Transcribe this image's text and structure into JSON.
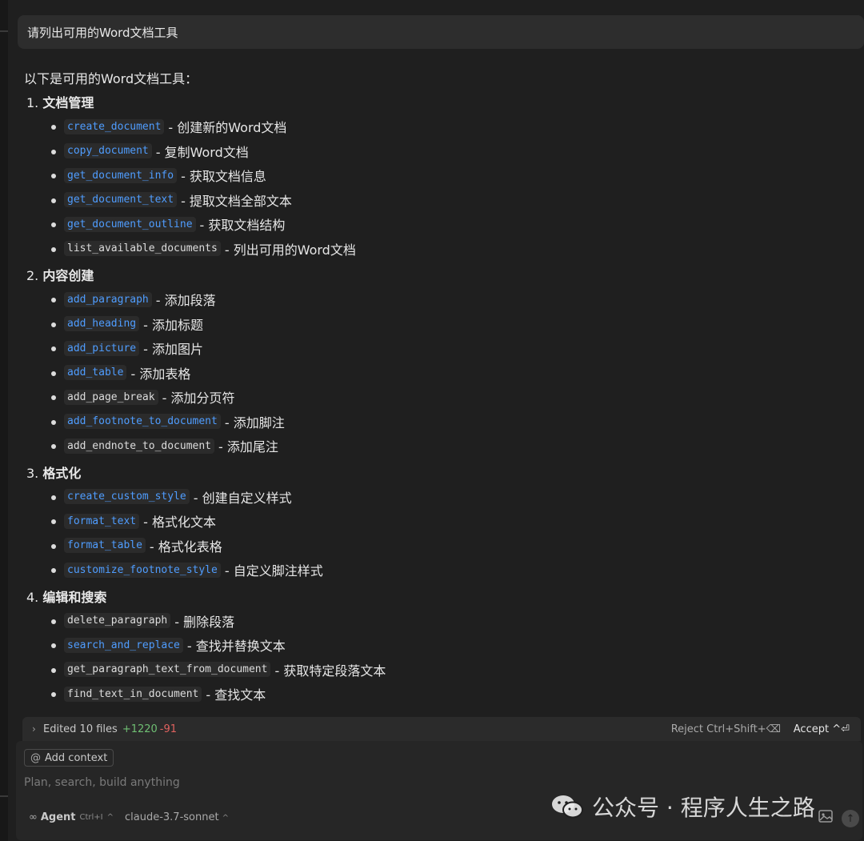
{
  "user_message": "请列出可用的Word文档工具",
  "response": {
    "intro": "以下是可用的Word文档工具：",
    "sections": [
      {
        "number": "1.",
        "title": "文档管理",
        "items": [
          {
            "code": "create_document",
            "desc": "- 创建新的Word文档",
            "link": true
          },
          {
            "code": "copy_document",
            "desc": "- 复制Word文档",
            "link": true
          },
          {
            "code": "get_document_info",
            "desc": "- 获取文档信息",
            "link": true
          },
          {
            "code": "get_document_text",
            "desc": "- 提取文档全部文本",
            "link": true
          },
          {
            "code": "get_document_outline",
            "desc": "- 获取文档结构",
            "link": true
          },
          {
            "code": "list_available_documents",
            "desc": "- 列出可用的Word文档",
            "link": false
          }
        ]
      },
      {
        "number": "2.",
        "title": "内容创建",
        "items": [
          {
            "code": "add_paragraph",
            "desc": "- 添加段落",
            "link": true
          },
          {
            "code": "add_heading",
            "desc": "- 添加标题",
            "link": true
          },
          {
            "code": "add_picture",
            "desc": "- 添加图片",
            "link": true
          },
          {
            "code": "add_table",
            "desc": "- 添加表格",
            "link": true
          },
          {
            "code": "add_page_break",
            "desc": "- 添加分页符",
            "link": false
          },
          {
            "code": "add_footnote_to_document",
            "desc": "- 添加脚注",
            "link": true
          },
          {
            "code": "add_endnote_to_document",
            "desc": "- 添加尾注",
            "link": false
          }
        ]
      },
      {
        "number": "3.",
        "title": "格式化",
        "items": [
          {
            "code": "create_custom_style",
            "desc": "- 创建自定义样式",
            "link": true
          },
          {
            "code": "format_text",
            "desc": "- 格式化文本",
            "link": true
          },
          {
            "code": "format_table",
            "desc": "- 格式化表格",
            "link": true
          },
          {
            "code": "customize_footnote_style",
            "desc": "- 自定义脚注样式",
            "link": true
          }
        ]
      },
      {
        "number": "4.",
        "title": "编辑和搜索",
        "items": [
          {
            "code": "delete_paragraph",
            "desc": "- 删除段落",
            "link": false
          },
          {
            "code": "search_and_replace",
            "desc": "- 查找并替换文本",
            "link": true
          },
          {
            "code": "get_paragraph_text_from_document",
            "desc": "- 获取特定段落文本",
            "link": false
          },
          {
            "code": "find_text_in_document",
            "desc": "- 查找文本",
            "link": false
          }
        ]
      }
    ]
  },
  "edit_bar": {
    "label": "Edited 10 files",
    "added": "+1220",
    "removed": "-91",
    "reject": "Reject Ctrl+Shift+⌫",
    "accept": "Accept ^⏎"
  },
  "composer": {
    "add_context": "Add context",
    "placeholder": "Plan, search, build anything",
    "agent_label": "Agent",
    "agent_shortcut": "Ctrl+I",
    "model": "claude-3.7-sonnet"
  },
  "watermark": "公众号 · 程序人生之路",
  "colors": {
    "background": "#1f1f1f",
    "link_code": "#4f9dff",
    "added": "#6fbf73",
    "removed": "#e0625f"
  }
}
